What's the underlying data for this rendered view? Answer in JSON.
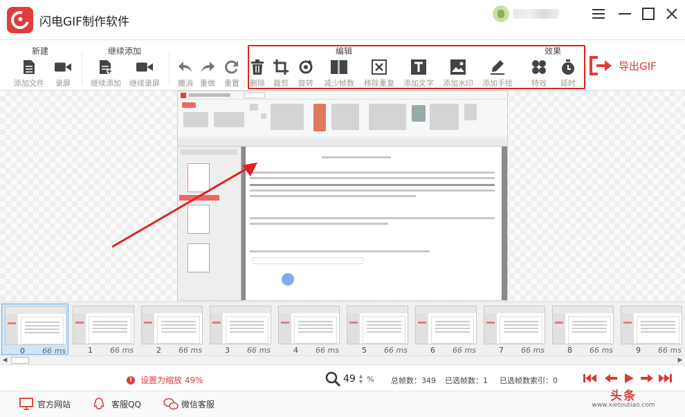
{
  "app": {
    "title": "闪电GIF制作软件"
  },
  "toolbar": {
    "groups": {
      "new": "新建",
      "continue_add": "继续添加",
      "edit": "编辑",
      "effects": "效果"
    },
    "tools": {
      "add_file": "添加文件",
      "record": "录屏",
      "continue_add_file": "继续添加",
      "continue_record": "继续录屏",
      "undo": "撤消",
      "redo": "重做",
      "reset": "重置",
      "delete": "删除",
      "crop": "裁剪",
      "rotate": "旋转",
      "reduce_frames": "减少帧数",
      "remove_duplicates": "移除重复",
      "add_text": "添加文字",
      "add_watermark": "添加水印",
      "add_handwriting": "添加手绘",
      "effects": "特效",
      "delay": "延时"
    },
    "export_label": "导出GIF",
    "highlight_color": "#e02020"
  },
  "frames": [
    {
      "index": "0",
      "ms": "66 ms",
      "selected": true
    },
    {
      "index": "1",
      "ms": "66 ms"
    },
    {
      "index": "2",
      "ms": "66 ms"
    },
    {
      "index": "3",
      "ms": "66 ms"
    },
    {
      "index": "4",
      "ms": "66 ms"
    },
    {
      "index": "5",
      "ms": "66 ms"
    },
    {
      "index": "6",
      "ms": "66 ms"
    },
    {
      "index": "7",
      "ms": "66 ms"
    },
    {
      "index": "8",
      "ms": "66 ms"
    },
    {
      "index": "9",
      "ms": "66 ms"
    }
  ],
  "status": {
    "warning": "设置为缩放 49%",
    "zoom_value": "49",
    "zoom_unit": "%",
    "total_frames": "总帧数：349",
    "selected_frames": "已选帧数：1",
    "selected_index": "已选帧数索引：0"
  },
  "footer": {
    "website": "官方网站",
    "qq": "客服QQ",
    "wechat": "微信客服"
  },
  "watermark": {
    "main": "头条",
    "sub": "www.xietoutiao.com"
  },
  "colors": {
    "brand": "#e23b3b",
    "selected_frame": "#cfe6f8"
  }
}
